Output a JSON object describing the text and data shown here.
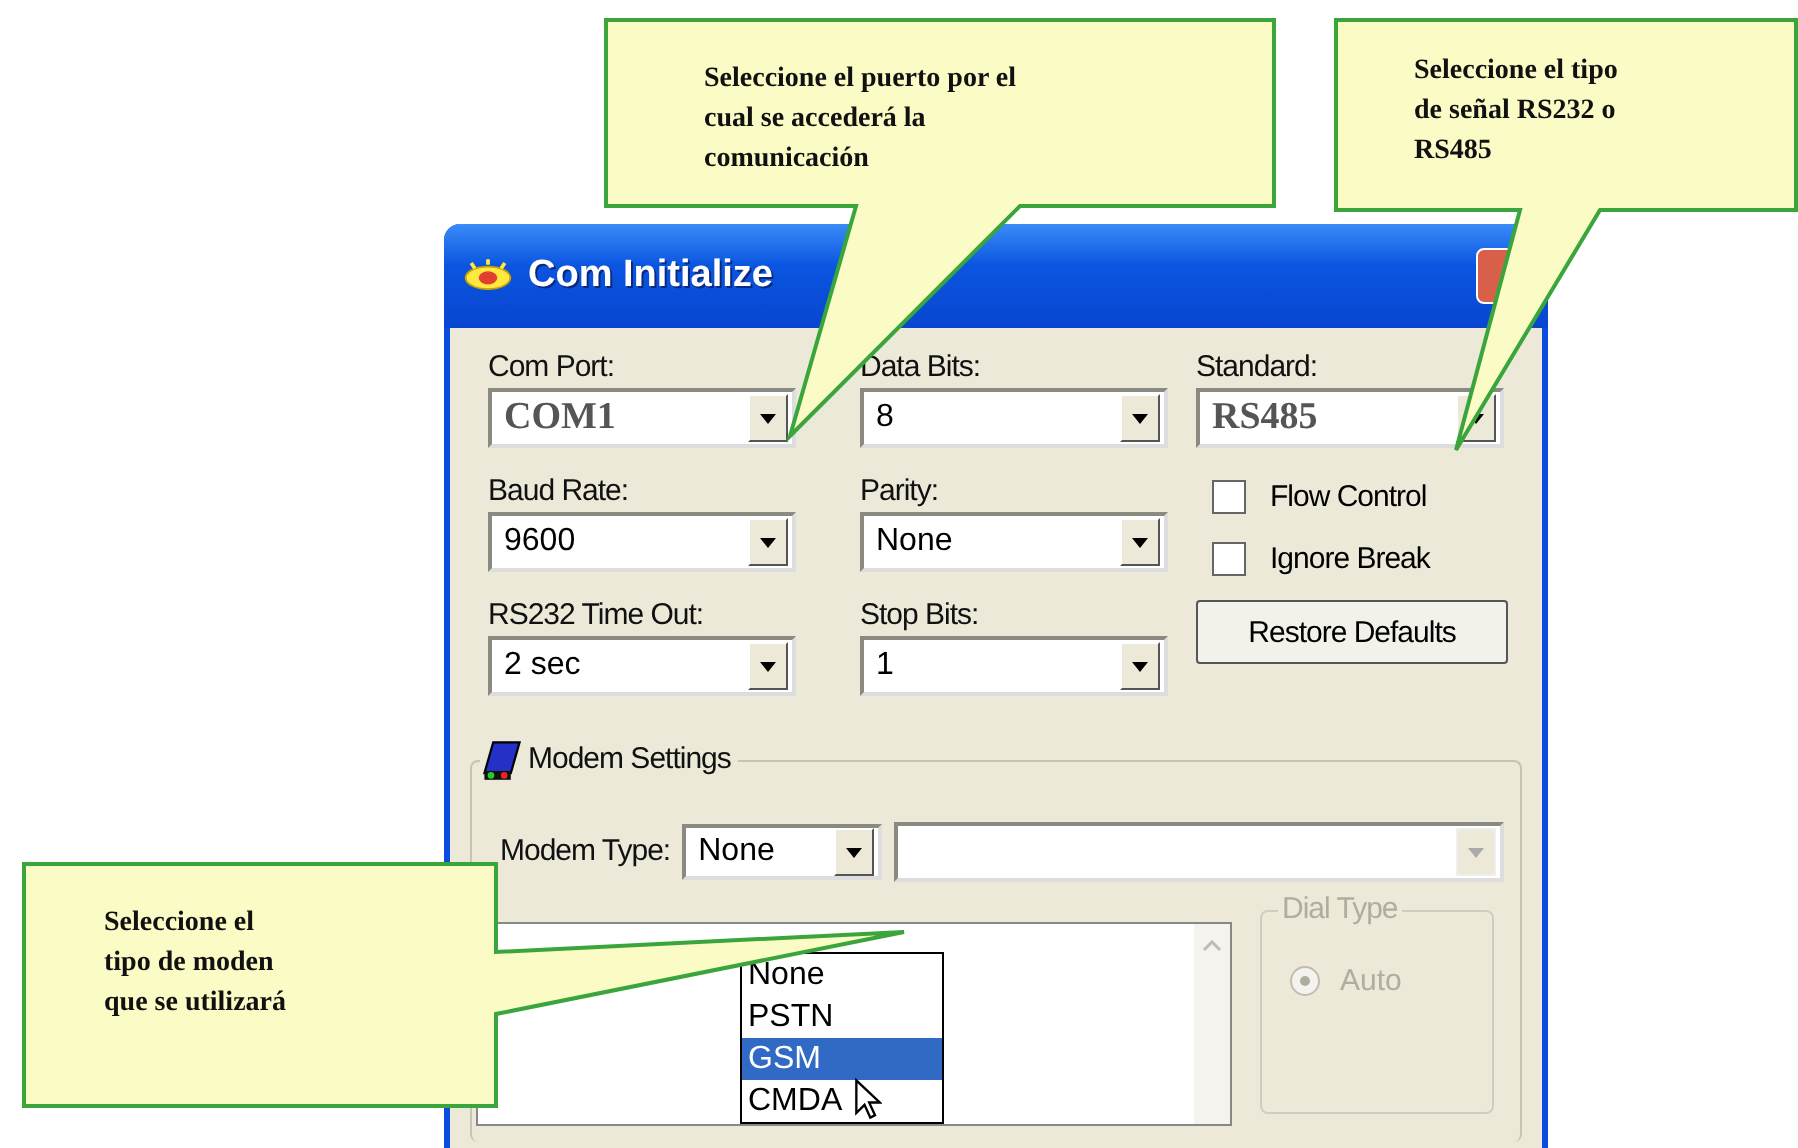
{
  "callouts": [
    {
      "text": "Seleccione el puerto por el cual se accederá la comunicación"
    },
    {
      "text": "Seleccione el tipo de señal RS232 o RS485"
    },
    {
      "text": "Seleccione el tipo de moden que se utilizará"
    }
  ],
  "window": {
    "title": "Com Initialize"
  },
  "columns": [
    [
      {
        "label": "Com Port:",
        "value": "COM1",
        "kind": "serif"
      },
      {
        "label": "Baud Rate:",
        "value": "9600",
        "kind": "plain"
      },
      {
        "label": "RS232 Time Out:",
        "value": "2 sec",
        "kind": "plain"
      }
    ],
    [
      {
        "label": "Data Bits:",
        "value": "8",
        "kind": "plain"
      },
      {
        "label": "Parity:",
        "value": "None",
        "kind": "plain"
      },
      {
        "label": "Stop Bits:",
        "value": "1",
        "kind": "plain"
      }
    ],
    [
      {
        "label": "Standard:",
        "value": "RS485",
        "kind": "serif"
      }
    ]
  ],
  "checkboxes": [
    {
      "label": "Flow Control",
      "checked": false
    },
    {
      "label": "Ignore Break",
      "checked": false
    }
  ],
  "restore_button": "Restore Defaults",
  "modem": {
    "title": "Modem Settings",
    "type_label": "Modem Type:",
    "type_value": "None",
    "second_combo": {
      "disabled": true
    },
    "dropdown": [
      {
        "label": "None",
        "selected": false
      },
      {
        "label": "PSTN",
        "selected": false
      },
      {
        "label": "GSM",
        "selected": true
      },
      {
        "label": "CMDA",
        "selected": false
      }
    ],
    "dial_type": {
      "title": "Dial Type",
      "disabled": true,
      "options": [
        {
          "label": "Auto",
          "selected": true
        }
      ]
    }
  }
}
